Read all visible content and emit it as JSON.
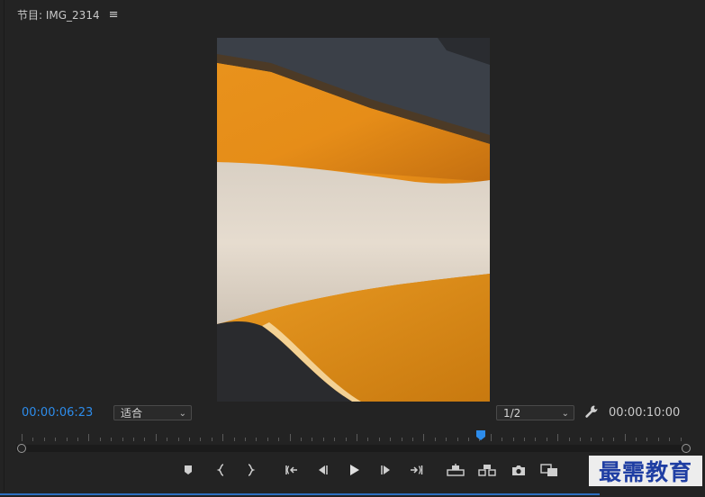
{
  "panel": {
    "title": "节目: IMG_2314",
    "menu_icon": "hamburger-icon"
  },
  "viewer": {
    "content": "video frame of forearm resting on orange table"
  },
  "controls": {
    "current_timecode": "00:00:06:23",
    "fit_select": {
      "value": "适合"
    },
    "resolution_select": {
      "value": "1/2"
    },
    "total_timecode": "00:00:10:00",
    "accent_color": "#2d8ceb"
  },
  "timeline": {
    "playhead_position_fraction": 0.69
  },
  "transport": {
    "buttons": [
      "add-marker",
      "mark-in",
      "mark-out",
      "go-to-in",
      "step-back",
      "play",
      "step-forward",
      "go-to-out",
      "lift",
      "extract",
      "export-frame",
      "comparison-view"
    ]
  },
  "watermark": {
    "text": "最需教育"
  }
}
